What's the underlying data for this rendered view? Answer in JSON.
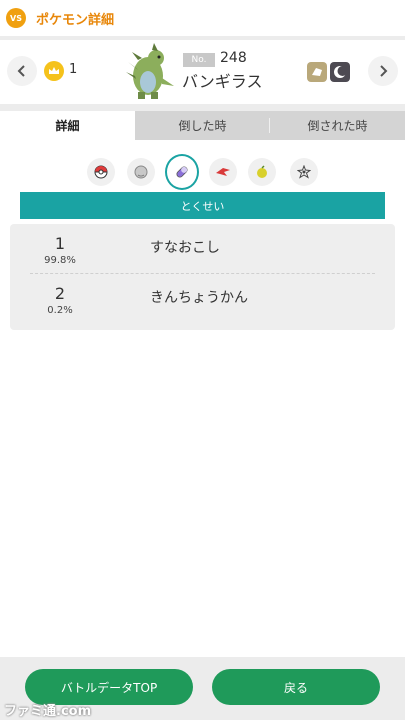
{
  "app_bar": {
    "title": "ポケモン詳細",
    "badge_text": "VS"
  },
  "pokemon": {
    "rank_value": "1",
    "no_label": "No.",
    "dex_number": "248",
    "name": "バンギラス",
    "type_icons": [
      "rock-type-icon",
      "dark-type-icon"
    ]
  },
  "tabs": [
    {
      "label": "詳細",
      "active": true
    },
    {
      "label": "倒した時",
      "active": false
    },
    {
      "label": "倒された時",
      "active": false
    }
  ],
  "categories": [
    {
      "icon": "pokeball-icon",
      "selected": false
    },
    {
      "icon": "ability-orb-icon",
      "selected": false
    },
    {
      "icon": "capsule-icon",
      "selected": true
    },
    {
      "icon": "attack-move-icon",
      "selected": false
    },
    {
      "icon": "held-item-icon",
      "selected": false
    },
    {
      "icon": "nature-icon",
      "selected": false
    }
  ],
  "section": {
    "title": "とくせい"
  },
  "abilities": [
    {
      "rank": "1",
      "percent": "99.8%",
      "name": "すなおこし"
    },
    {
      "rank": "2",
      "percent": "0.2%",
      "name": "きんちょうかん"
    }
  ],
  "footer": {
    "battle_data_label": "バトルデータTOP",
    "back_label": "戻る"
  },
  "watermark": "ファミ通.com",
  "colors": {
    "accent": "#1aa3a3",
    "button_green": "#1f9a5a",
    "title_orange": "#e8870a",
    "crown_gold": "#f5c21b"
  }
}
